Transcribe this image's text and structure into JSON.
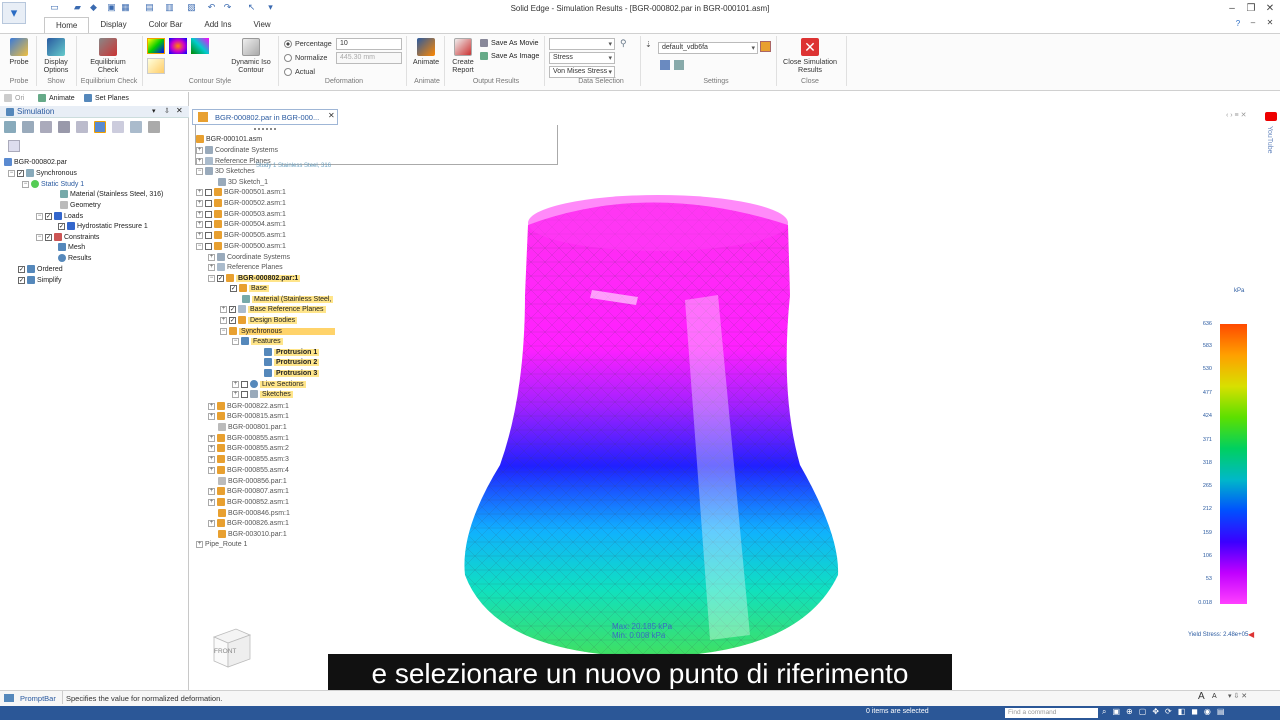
{
  "app": {
    "title": "Solid Edge - Simulation Results - [BGR-000802.par in BGR-000101.asm]"
  },
  "tabs": [
    "Home",
    "Display",
    "Color Bar",
    "Add Ins",
    "View"
  ],
  "ribbon": {
    "probe": "Probe",
    "display_options": "Display Options",
    "equilibrium_check": "Equilibrium Check",
    "dynamic_iso": "Dynamic Iso Contour",
    "percentage_label": "Percentage",
    "percentage_value": "10",
    "normalize_label": "Normalize",
    "normalize_value": "445.30 mm",
    "actual_label": "Actual",
    "animate": "Animate",
    "create_report": "Create Report",
    "save_movie": "Save As Movie",
    "save_image": "Save As Image",
    "data_sel_1": "Stress",
    "data_sel_2": "Von Mises Stress",
    "settings_value": "default_vdb6fa",
    "close_results": "Close Simulation Results",
    "groups": {
      "probe": "Probe",
      "show": "Show",
      "equil": "Equilibrium Check",
      "contour": "Contour Style",
      "deform": "Deformation",
      "animate": "Animate",
      "output": "Output Results",
      "datasel": "Data Selection",
      "settings": "Settings",
      "close": "Close"
    }
  },
  "leftpanel": {
    "toolbar_items": [
      "Ori",
      "Animate",
      "Set Planes"
    ],
    "panel_title": "Simulation",
    "tree": [
      {
        "label": "BGR-000802.par",
        "level": 0
      },
      {
        "label": "Synchronous",
        "level": 1
      },
      {
        "label": "Static Study 1",
        "level": 2
      },
      {
        "label": "Material (Stainless Steel, 316)",
        "level": 3
      },
      {
        "label": "Geometry",
        "level": 3
      },
      {
        "label": "Loads",
        "level": 3
      },
      {
        "label": "Hydrostatic Pressure 1",
        "level": 4
      },
      {
        "label": "Constraints",
        "level": 3
      },
      {
        "label": "Mesh",
        "level": 4
      },
      {
        "label": "Results",
        "level": 4
      },
      {
        "label": "Ordered",
        "level": 1
      },
      {
        "label": "Simplify",
        "level": 1
      }
    ]
  },
  "doc_tab": "BGR-000802.par in BGR-000...",
  "pathfinder": {
    "items": [
      "BGR-000101.asm",
      "Coordinate Systems",
      "Reference Planes",
      "3D Sketches",
      "3D Sketch_1",
      "BGR-000501.asm:1",
      "BGR-000502.asm:1",
      "BGR-000503.asm:1",
      "BGR-000504.asm:1",
      "BGR-000505.asm:1",
      "BGR-000500.asm:1",
      "Coordinate Systems",
      "Reference Planes",
      "BGR-000802.par:1",
      "Base",
      "Material (Stainless Steel,",
      "Base Reference Planes",
      "Design Bodies",
      "Synchronous",
      "Features",
      "Protrusion 1",
      "Protrusion 2",
      "Protrusion 3",
      "Live Sections",
      "Sketches",
      "BGR-000822.asm:1",
      "BGR-000815.asm:1",
      "BGR-000801.par:1",
      "BGR-000855.asm:1",
      "BGR-000855.asm:2",
      "BGR-000855.asm:3",
      "BGR-000855.asm:4",
      "BGR-000856.par:1",
      "BGR-000807.asm:1",
      "BGR-000852.asm:1",
      "BGR-000846.psm:1",
      "BGR-000826.asm:1",
      "BGR-003010.par:1",
      "Pipe_Route 1"
    ],
    "ghost_text": "Study 1 Stainless Steel, 316"
  },
  "viewport": {
    "units": "kPa",
    "scale": [
      "636",
      "583",
      "530",
      "477",
      "424",
      "371",
      "318",
      "265",
      "212",
      "159",
      "106",
      "53",
      "0.018"
    ],
    "max": "Max: 20.185 kPa",
    "min": "Min: 0.008 kPa",
    "yield": "Yield Stress: 2.48e+05",
    "cube_label": "FRONT",
    "youtube": "YouTube"
  },
  "subtitle": "e selezionare un nuovo punto di riferimento",
  "promptbar": {
    "label": "PromptBar",
    "text": "Specifies the value for normalized deformation."
  },
  "status": {
    "items_selected": "0 items are selected",
    "find_placeholder": "Find a command"
  },
  "colors": {
    "accent": "#2b5797",
    "highlight": "#ffe58a"
  }
}
